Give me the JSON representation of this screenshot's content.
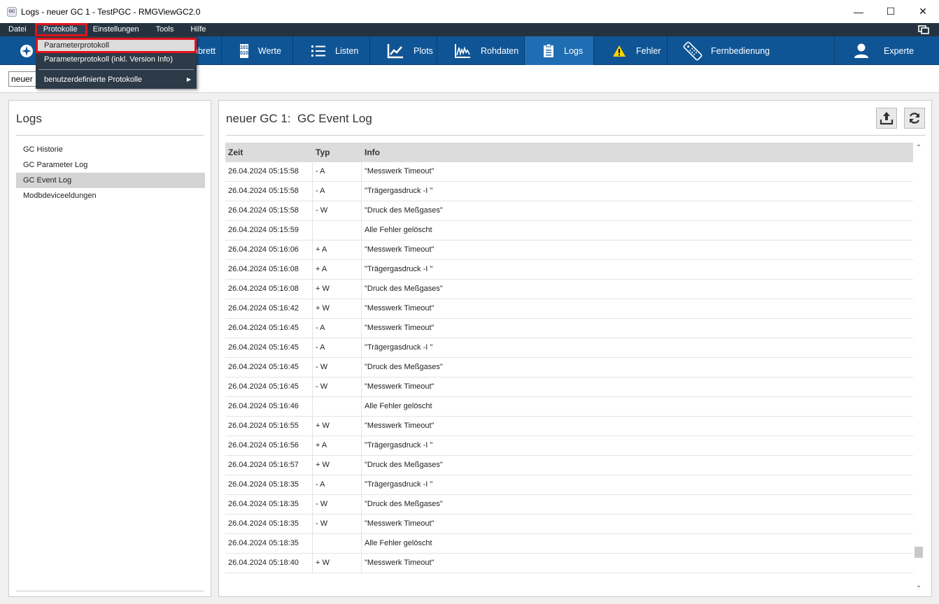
{
  "window": {
    "title": "Logs - neuer GC 1 - TestPGC - RMGViewGC2.0",
    "icon_label": "GC",
    "controls": {
      "minimize": "—",
      "maximize": "☐",
      "close": "✕"
    }
  },
  "menu": {
    "items": [
      "Datei",
      "Protokolle",
      "Einstellungen",
      "Tools",
      "Hilfe"
    ]
  },
  "dropdown": {
    "items": [
      "Parameterprotokoll",
      "Parameterprotokoll (inkl. Version Info)",
      "benutzerdefinierte Protokolle"
    ],
    "submenu_arrow": "▶"
  },
  "toolbar": {
    "items": [
      {
        "label": "nbrett",
        "icon": "dashboard-icon"
      },
      {
        "label": "Werte",
        "icon": "binary-icon"
      },
      {
        "label": "Listen",
        "icon": "list-icon"
      },
      {
        "label": "Plots",
        "icon": "chart-icon"
      },
      {
        "label": "Rohdaten",
        "icon": "raw-data-icon"
      },
      {
        "label": "Logs",
        "icon": "clipboard-icon"
      },
      {
        "label": "Fehler",
        "icon": "warning-icon"
      },
      {
        "label": "Fernbedienung",
        "icon": "remote-icon"
      },
      {
        "label": "Experte",
        "icon": "user-icon"
      }
    ],
    "binary_icon_text": [
      "101",
      "010"
    ],
    "warning_color": "#ffd500",
    "active_label": "Logs"
  },
  "search": {
    "value": "neuer"
  },
  "left_panel": {
    "title": "Logs",
    "items": [
      "GC Historie",
      "GC Parameter Log",
      "GC Event Log",
      "Modbdeviceeldungen"
    ],
    "selected_index": 2
  },
  "right_panel": {
    "title": "neuer GC 1:  GC Event Log",
    "buttons": [
      "export-icon",
      "refresh-icon"
    ]
  },
  "table": {
    "columns": [
      "Zeit",
      "Typ",
      "Info"
    ],
    "rows": [
      [
        "26.04.2024 05:15:58",
        "- A",
        " \"Messwerk Timeout\""
      ],
      [
        "26.04.2024 05:15:58",
        "- A",
        " \"Trägergasdruck -I \""
      ],
      [
        "26.04.2024 05:15:58",
        "- W",
        " \"Druck des Meßgases\""
      ],
      [
        "26.04.2024 05:15:59",
        "",
        "Alle Fehler gelöscht"
      ],
      [
        "26.04.2024 05:16:06",
        "+ A",
        " \"Messwerk Timeout\""
      ],
      [
        "26.04.2024 05:16:08",
        "+ A",
        " \"Trägergasdruck -I \""
      ],
      [
        "26.04.2024 05:16:08",
        "+ W",
        " \"Druck des Meßgases\""
      ],
      [
        "26.04.2024 05:16:42",
        "+ W",
        " \"Messwerk Timeout\""
      ],
      [
        "26.04.2024 05:16:45",
        "- A",
        " \"Messwerk Timeout\""
      ],
      [
        "26.04.2024 05:16:45",
        "- A",
        " \"Trägergasdruck -I \""
      ],
      [
        "26.04.2024 05:16:45",
        "- W",
        " \"Druck des Meßgases\""
      ],
      [
        "26.04.2024 05:16:45",
        "- W",
        " \"Messwerk Timeout\""
      ],
      [
        "26.04.2024 05:16:46",
        "",
        "Alle Fehler gelöscht"
      ],
      [
        "26.04.2024 05:16:55",
        "+ W",
        " \"Messwerk Timeout\""
      ],
      [
        "26.04.2024 05:16:56",
        "+ A",
        " \"Trägergasdruck -I \""
      ],
      [
        "26.04.2024 05:16:57",
        "+ W",
        " \"Druck des Meßgases\""
      ],
      [
        "26.04.2024 05:18:35",
        "- A",
        " \"Trägergasdruck -I \""
      ],
      [
        "26.04.2024 05:18:35",
        "- W",
        " \"Druck des Meßgases\""
      ],
      [
        "26.04.2024 05:18:35",
        "- W",
        " \"Messwerk Timeout\""
      ],
      [
        "26.04.2024 05:18:35",
        "",
        "Alle Fehler gelöscht"
      ],
      [
        "26.04.2024 05:18:40",
        "+ W",
        " \"Messwerk Timeout\""
      ]
    ],
    "scroll_up": "⌃",
    "scroll_down": "⌄"
  },
  "colors": {
    "menubar": "#253340",
    "toolbar": "#0f5595",
    "toolbar_active": "#1f6db3",
    "highlight_box": "#e0141e"
  }
}
